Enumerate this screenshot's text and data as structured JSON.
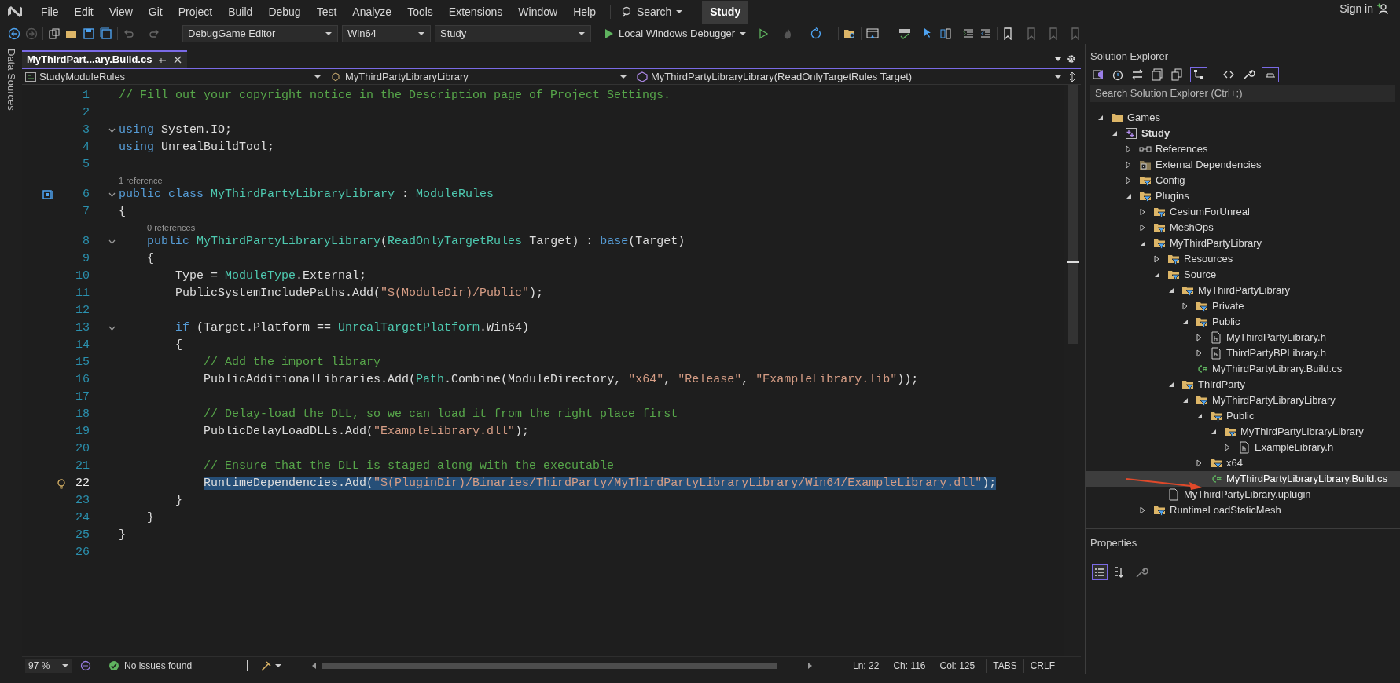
{
  "menu": [
    "File",
    "Edit",
    "View",
    "Git",
    "Project",
    "Build",
    "Debug",
    "Test",
    "Analyze",
    "Tools",
    "Extensions",
    "Window",
    "Help"
  ],
  "search": {
    "label": "Search"
  },
  "solution_badge": "Study",
  "account": {
    "label": "Sign in"
  },
  "toolbar": {
    "configuration": "DebugGame Editor",
    "platform": "Win64",
    "startup_project": "Study",
    "debugger": "Local Windows Debugger"
  },
  "side_tab": "Data Sources",
  "editor": {
    "tabs": [
      {
        "label": "MyThirdPart...ary.Build.cs",
        "selected": true
      }
    ],
    "nav": [
      "StudyModuleRules",
      "MyThirdPartyLibraryLibrary",
      "MyThirdPartyLibraryLibrary(ReadOnlyTargetRules Target)"
    ],
    "lines": [
      {
        "kind": "code",
        "number": "1",
        "tokens": [
          {
            "kind": "comment",
            "text": "// Fill out your copyright notice in the Description page of Project Settings."
          }
        ]
      },
      {
        "kind": "code",
        "number": "2"
      },
      {
        "kind": "code",
        "number": "3",
        "fold": true,
        "tokens": [
          {
            "kind": "keyword",
            "text": "using"
          },
          {
            "kind": "plain",
            "text": " System.IO;"
          }
        ]
      },
      {
        "kind": "code",
        "number": "4",
        "tokens": [
          {
            "kind": "keyword",
            "text": "using"
          },
          {
            "kind": "plain",
            "text": " UnrealBuildTool;"
          }
        ]
      },
      {
        "kind": "code",
        "number": "5"
      },
      {
        "kind": "codelens",
        "text": "1 reference"
      },
      {
        "kind": "code",
        "number": "6",
        "fold": true,
        "bookmark": true,
        "tokens": [
          {
            "kind": "keyword",
            "text": "public class "
          },
          {
            "kind": "type",
            "text": "MyThirdPartyLibraryLibrary"
          },
          {
            "kind": "plain",
            "text": " : "
          },
          {
            "kind": "type",
            "text": "ModuleRules"
          }
        ]
      },
      {
        "kind": "code",
        "number": "7",
        "tokens": [
          {
            "kind": "plain",
            "text": "{"
          }
        ]
      },
      {
        "kind": "codelens",
        "text": "0 references"
      },
      {
        "kind": "code",
        "number": "8",
        "fold": true,
        "tokens": [
          {
            "kind": "keyword",
            "text": "    public "
          },
          {
            "kind": "type",
            "text": "MyThirdPartyLibraryLibrary"
          },
          {
            "kind": "plain",
            "text": "("
          },
          {
            "kind": "type",
            "text": "ReadOnlyTargetRules"
          },
          {
            "kind": "plain",
            "text": " Target) : "
          },
          {
            "kind": "keyword",
            "text": "base"
          },
          {
            "kind": "plain",
            "text": "(Target)"
          }
        ]
      },
      {
        "kind": "code",
        "number": "9",
        "tokens": [
          {
            "kind": "plain",
            "text": "    {"
          }
        ]
      },
      {
        "kind": "code",
        "number": "10",
        "tokens": [
          {
            "kind": "plain",
            "text": "        Type = "
          },
          {
            "kind": "type",
            "text": "ModuleType"
          },
          {
            "kind": "plain",
            "text": ".External;"
          }
        ]
      },
      {
        "kind": "code",
        "number": "11",
        "tokens": [
          {
            "kind": "plain",
            "text": "        PublicSystemIncludePaths.Add("
          },
          {
            "kind": "string",
            "text": "\"$(ModuleDir)/Public\""
          },
          {
            "kind": "plain",
            "text": ");"
          }
        ]
      },
      {
        "kind": "code",
        "number": "12"
      },
      {
        "kind": "code",
        "number": "13",
        "fold": true,
        "tokens": [
          {
            "kind": "keyword",
            "text": "        if"
          },
          {
            "kind": "plain",
            "text": " (Target.Platform == "
          },
          {
            "kind": "type",
            "text": "UnrealTargetPlatform"
          },
          {
            "kind": "plain",
            "text": ".Win64)"
          }
        ]
      },
      {
        "kind": "code",
        "number": "14",
        "tokens": [
          {
            "kind": "plain",
            "text": "        {"
          }
        ]
      },
      {
        "kind": "code",
        "number": "15",
        "tokens": [
          {
            "kind": "comment",
            "text": "            // Add the import library"
          }
        ]
      },
      {
        "kind": "code",
        "number": "16",
        "tokens": [
          {
            "kind": "plain",
            "text": "            PublicAdditionalLibraries.Add("
          },
          {
            "kind": "type",
            "text": "Path"
          },
          {
            "kind": "plain",
            "text": ".Combine(ModuleDirectory, "
          },
          {
            "kind": "string",
            "text": "\"x64\""
          },
          {
            "kind": "plain",
            "text": ", "
          },
          {
            "kind": "string",
            "text": "\"Release\""
          },
          {
            "kind": "plain",
            "text": ", "
          },
          {
            "kind": "string",
            "text": "\"ExampleLibrary.lib\""
          },
          {
            "kind": "plain",
            "text": "));"
          }
        ]
      },
      {
        "kind": "code",
        "number": "17"
      },
      {
        "kind": "code",
        "number": "18",
        "tokens": [
          {
            "kind": "comment",
            "text": "            // Delay-load the DLL, so we can load it from the right place first"
          }
        ]
      },
      {
        "kind": "code",
        "number": "19",
        "tokens": [
          {
            "kind": "plain",
            "text": "            PublicDelayLoadDLLs.Add("
          },
          {
            "kind": "string",
            "text": "\"ExampleLibrary.dll\""
          },
          {
            "kind": "plain",
            "text": ");"
          }
        ]
      },
      {
        "kind": "code",
        "number": "20"
      },
      {
        "kind": "code",
        "number": "21",
        "tokens": [
          {
            "kind": "comment",
            "text": "            // Ensure that the DLL is staged along with the executable"
          }
        ]
      },
      {
        "kind": "code",
        "number": "22",
        "selected": true,
        "quick_action": true,
        "tokens": [
          {
            "kind": "plain",
            "text": "            RuntimeDependencies.Add("
          },
          {
            "kind": "string",
            "text": "\"$(PluginDir)/Binaries/ThirdParty/MyThirdPartyLibraryLibrary/Win64/ExampleLibrary.dll\""
          },
          {
            "kind": "plain",
            "text": ");"
          }
        ]
      },
      {
        "kind": "code",
        "number": "23",
        "tokens": [
          {
            "kind": "plain",
            "text": "        }"
          }
        ]
      },
      {
        "kind": "code",
        "number": "24",
        "tokens": [
          {
            "kind": "plain",
            "text": "    }"
          }
        ]
      },
      {
        "kind": "code",
        "number": "25",
        "tokens": [
          {
            "kind": "plain",
            "text": "}"
          }
        ]
      },
      {
        "kind": "code",
        "number": "26"
      }
    ]
  },
  "status": {
    "zoom": "97 %",
    "issues": "No issues found",
    "line": "Ln: 22",
    "char": "Ch: 116",
    "col": "Col: 125",
    "indent": "TABS",
    "eol": "CRLF"
  },
  "solution_explorer": {
    "title": "Solution Explorer",
    "search": {
      "placeholder": "Search Solution Explorer (Ctrl+;)"
    },
    "tree": [
      {
        "label": "Games",
        "kind": "folder",
        "expanded": true,
        "selected": false,
        "children": [
          {
            "label": "Study",
            "kind": "project",
            "expanded": true,
            "selected": false,
            "children": [
              {
                "label": "References",
                "kind": "references",
                "expanded": false,
                "selected": false
              },
              {
                "label": "External Dependencies",
                "kind": "external",
                "expanded": false,
                "selected": false
              },
              {
                "label": "Config",
                "kind": "filter",
                "expanded": false,
                "selected": false
              },
              {
                "label": "Plugins",
                "kind": "filter",
                "expanded": true,
                "selected": false,
                "children": [
                  {
                    "label": "CesiumForUnreal",
                    "kind": "filter",
                    "expanded": false,
                    "selected": false
                  },
                  {
                    "label": "MeshOps",
                    "kind": "filter",
                    "expanded": false,
                    "selected": false
                  },
                  {
                    "label": "MyThirdPartyLibrary",
                    "kind": "filter",
                    "expanded": true,
                    "selected": false,
                    "children": [
                      {
                        "label": "Resources",
                        "kind": "filter",
                        "expanded": false,
                        "selected": false
                      },
                      {
                        "label": "Source",
                        "kind": "filter",
                        "expanded": true,
                        "selected": false,
                        "children": [
                          {
                            "label": "MyThirdPartyLibrary",
                            "kind": "filter",
                            "expanded": true,
                            "selected": false,
                            "children": [
                              {
                                "label": "Private",
                                "kind": "filter",
                                "expanded": false,
                                "selected": false
                              },
                              {
                                "label": "Public",
                                "kind": "filter",
                                "expanded": true,
                                "selected": false,
                                "children": [
                                  {
                                    "label": "MyThirdPartyLibrary.h",
                                    "kind": "header",
                                    "expanded": false,
                                    "selected": false
                                  },
                                  {
                                    "label": "ThirdPartyBPLibrary.h",
                                    "kind": "header",
                                    "expanded": false,
                                    "selected": false
                                  }
                                ]
                              },
                              {
                                "label": "MyThirdPartyLibrary.Build.cs",
                                "kind": "csharp",
                                "selected": false
                              }
                            ]
                          },
                          {
                            "label": "ThirdParty",
                            "kind": "filter",
                            "expanded": true,
                            "selected": false,
                            "children": [
                              {
                                "label": "MyThirdPartyLibraryLibrary",
                                "kind": "filter",
                                "expanded": true,
                                "selected": false,
                                "children": [
                                  {
                                    "label": "Public",
                                    "kind": "filter",
                                    "expanded": true,
                                    "selected": false,
                                    "children": [
                                      {
                                        "label": "MyThirdPartyLibraryLibrary",
                                        "kind": "filter",
                                        "expanded": true,
                                        "selected": false,
                                        "children": [
                                          {
                                            "label": "ExampleLibrary.h",
                                            "kind": "header",
                                            "expanded": false,
                                            "selected": false
                                          }
                                        ]
                                      }
                                    ]
                                  },
                                  {
                                    "label": "x64",
                                    "kind": "filter",
                                    "expanded": false,
                                    "selected": false
                                  },
                                  {
                                    "label": "MyThirdPartyLibraryLibrary.Build.cs",
                                    "kind": "csharp",
                                    "selected": true
                                  }
                                ]
                              }
                            ]
                          }
                        ]
                      },
                      {
                        "label": "MyThirdPartyLibrary.uplugin",
                        "kind": "file",
                        "selected": false
                      }
                    ]
                  },
                  {
                    "label": "RuntimeLoadStaticMesh",
                    "kind": "filter",
                    "expanded": false,
                    "selected": false
                  }
                ]
              }
            ]
          }
        ]
      }
    ]
  },
  "properties": {
    "title": "Properties"
  }
}
